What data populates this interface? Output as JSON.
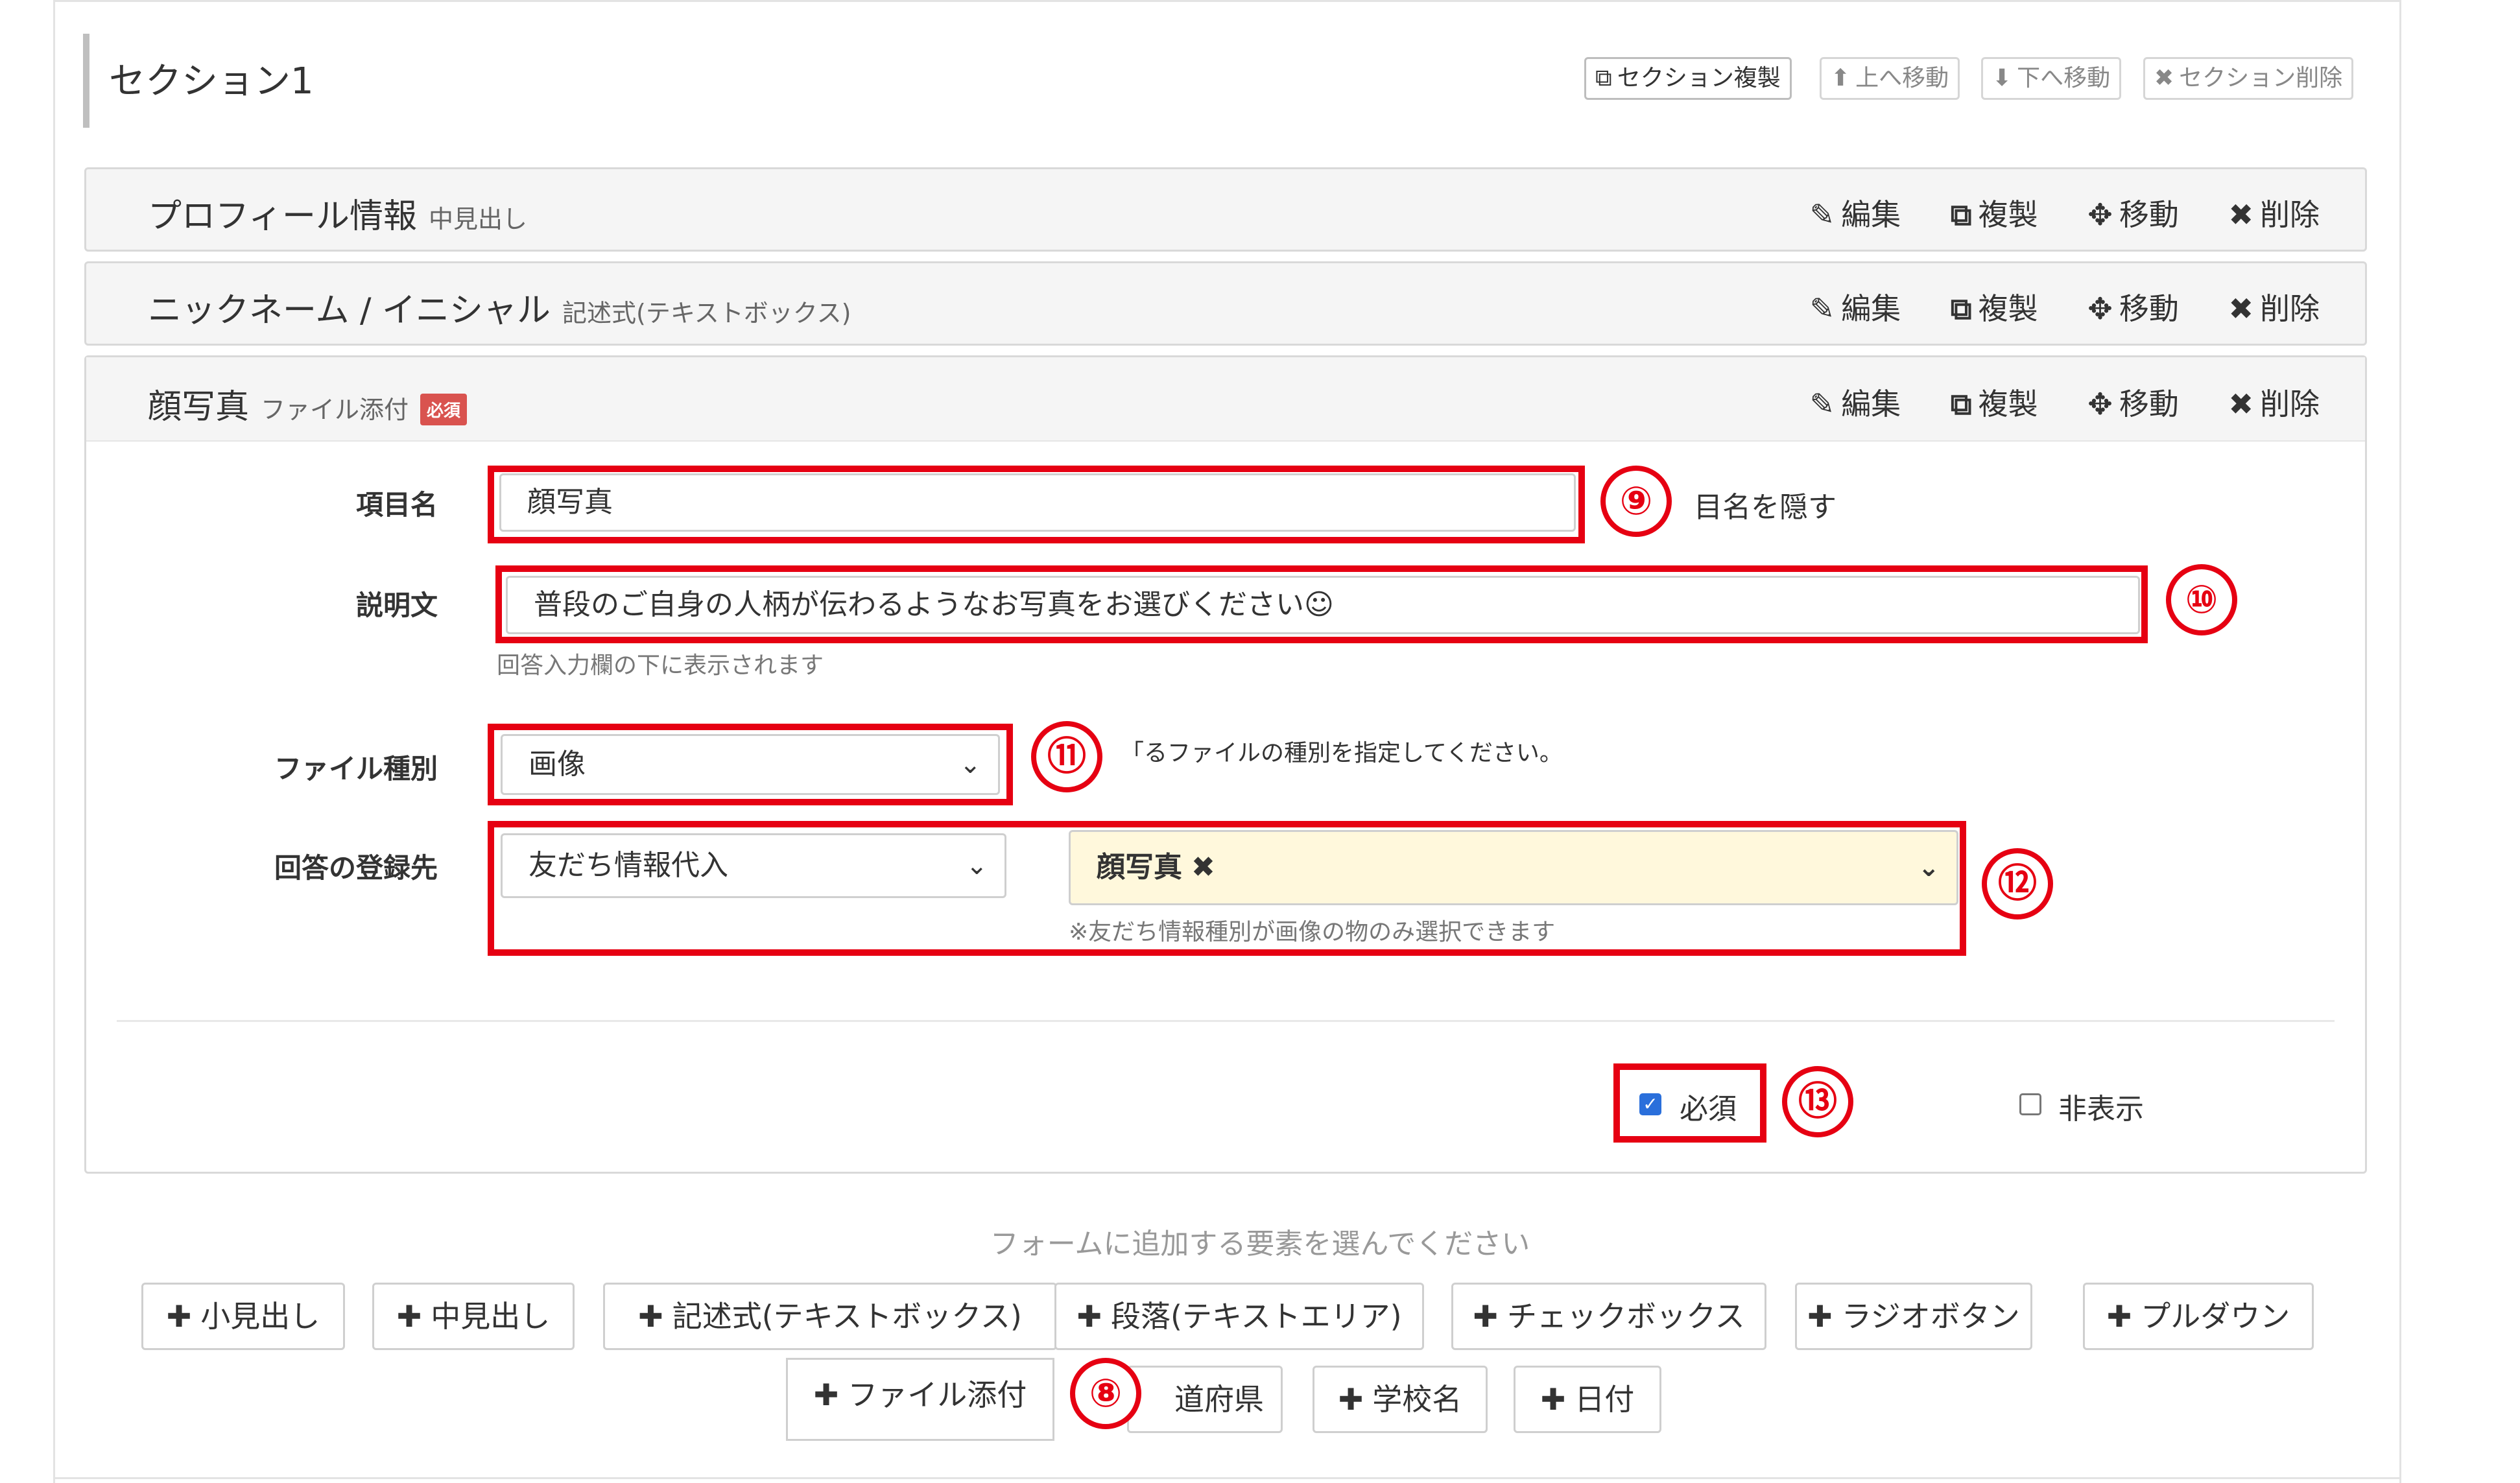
{
  "section": {
    "title": "セクション1",
    "buttons": [
      {
        "icon": "copy-icon",
        "glyph": "⧉",
        "label": "セクション複製"
      },
      {
        "icon": "arrow-up-icon",
        "glyph": "⬆",
        "label": "上へ移動"
      },
      {
        "icon": "arrow-down-icon",
        "glyph": "⬇",
        "label": "下へ移動"
      },
      {
        "icon": "close-icon",
        "glyph": "✖",
        "label": "セクション削除"
      }
    ]
  },
  "actions": {
    "edit": "編集",
    "copy": "複製",
    "move": "移動",
    "delete": "削除",
    "edit_glyph": "✎",
    "copy_glyph": "⧉",
    "move_glyph": "✥",
    "delete_glyph": "✖"
  },
  "panels": [
    {
      "title": "プロフィール情報",
      "type": "中見出し"
    },
    {
      "title": "ニックネーム / イニシャル",
      "type": "記述式(テキストボックス)"
    },
    {
      "title": "顔写真",
      "type": "ファイル添付",
      "badge": "必須"
    }
  ],
  "form": {
    "item_name_label": "項目名",
    "item_name_value": "顔写真",
    "hide_item_name": "目名を隠す",
    "description_label": "説明文",
    "description_value": "普段のご自身の人柄が伝わるようなお写真をお選びください☺",
    "description_hint": "回答入力欄の下に表示されます",
    "file_type_label": "ファイル種別",
    "file_type_value": "画像",
    "file_type_hint": "「るファイルの種別を指定してください。",
    "register_label": "回答の登録先",
    "register_value": "友だち情報代入",
    "register_target_tag": "顔写真",
    "register_target_hint": "※友だち情報種別が画像の物のみ選択できます",
    "required_label": "必須",
    "required_checked": true,
    "hidden_label": "非表示",
    "hidden_checked": false
  },
  "add_elements": {
    "caption": "フォームに追加する要素を選んでください",
    "row1": [
      "小見出し",
      "中見出し",
      "記述式(テキストボックス)",
      "段落(テキストエリア)",
      "チェックボックス",
      "ラジオボタン",
      "プルダウン"
    ],
    "row2": [
      "ファイル添付",
      "道府県",
      "学校名",
      "日付"
    ]
  },
  "callouts": [
    "⑧",
    "⑨",
    "⑩",
    "⑪",
    "⑫",
    "⑬"
  ],
  "colors": {
    "callout_red": "#e60012",
    "badge_red": "#d9534f",
    "target_bg": "#fff8dc"
  }
}
